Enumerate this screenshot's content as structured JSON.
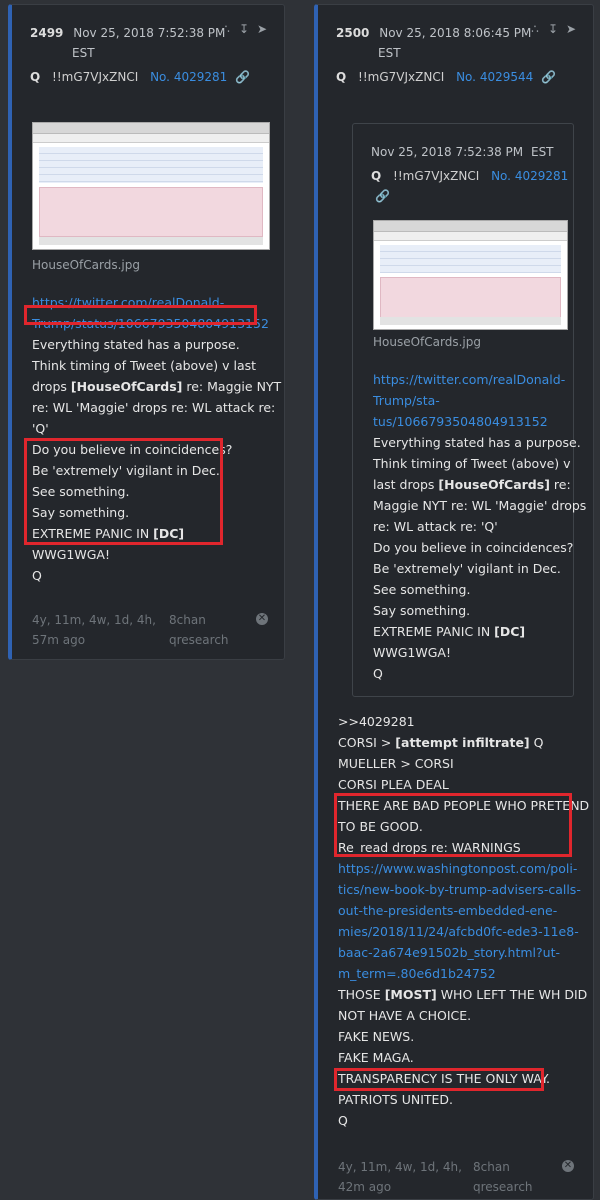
{
  "left_post": {
    "number": "2499",
    "date": "Nov 25, 2018 7:52:38 PM",
    "tz": "EST",
    "author": "Q",
    "tripcode": "!!mG7VJxZNCI",
    "post_no": "No. 4029281",
    "image_name": "HouseOfCards.jpg",
    "lines": [
      {
        "text": "https://twitter.com/realDonald-",
        "type": "link"
      },
      {
        "text": "Trump/status/1066793504804913152",
        "type": "link"
      },
      {
        "text": "Everything stated has a purpose.",
        "type": "text"
      },
      {
        "text": "Think timing of Tweet (above) v last",
        "type": "text"
      },
      {
        "text": "drops [HouseOfCards] re: Maggie NYT",
        "type": "text"
      },
      {
        "text": "re: WL 'Maggie' drops re: WL attack re:",
        "type": "text"
      },
      {
        "text": "'Q'",
        "type": "text"
      },
      {
        "text": "Do you believe in coincidences?",
        "type": "text"
      },
      {
        "text": "Be 'extremely' vigilant in Dec.",
        "type": "text"
      },
      {
        "text": "See something.",
        "type": "text"
      },
      {
        "text": "Say something.",
        "type": "text"
      },
      {
        "text": "EXTREME PANIC IN [DC]",
        "type": "text"
      },
      {
        "text": "WWG1WGA!",
        "type": "text"
      },
      {
        "text": "Q",
        "type": "text"
      }
    ],
    "footer_age": "4y, 11m, 4w, 1d, 4h,",
    "footer_age2": "57m ago",
    "footer_source": "8chan",
    "footer_source2": "qresearch"
  },
  "right_post": {
    "number": "2500",
    "date": "Nov 25, 2018 8:06:45 PM",
    "tz": "EST",
    "author": "Q",
    "tripcode": "!!mG7VJxZNCI",
    "post_no": "No. 4029544",
    "quoted": {
      "date": "Nov 25, 2018 7:52:38 PM",
      "tz": "EST",
      "author": "Q",
      "tripcode": "!!mG7VJxZNCI",
      "post_no": "No. 4029281",
      "image_name": "HouseOfCards.jpg",
      "lines": [
        {
          "text": "https://twitter.com/realDonald-",
          "type": "link"
        },
        {
          "text": "Trump/sta-",
          "type": "link"
        },
        {
          "text": "tus/1066793504804913152",
          "type": "link"
        },
        {
          "text": "Everything stated has a purpose.",
          "type": "text"
        },
        {
          "text": "Think timing of Tweet (above) v",
          "type": "text"
        },
        {
          "text": "last drops [HouseOfCards] re:",
          "type": "text"
        },
        {
          "text": "Maggie NYT re: WL 'Maggie' drops",
          "type": "text"
        },
        {
          "text": "re: WL attack re: 'Q'",
          "type": "text"
        },
        {
          "text": "Do you believe in coincidences?",
          "type": "text"
        },
        {
          "text": "Be 'extremely' vigilant in Dec.",
          "type": "text"
        },
        {
          "text": "See something.",
          "type": "text"
        },
        {
          "text": "Say something.",
          "type": "text"
        },
        {
          "text": "EXTREME PANIC IN [DC]",
          "type": "text"
        },
        {
          "text": "WWG1WGA!",
          "type": "text"
        },
        {
          "text": "Q",
          "type": "text"
        }
      ]
    },
    "lines": [
      {
        "text": ">>4029281",
        "type": "text"
      },
      {
        "text": "CORSI > [attempt infiltrate] Q",
        "type": "text"
      },
      {
        "text": "MUELLER > CORSI",
        "type": "text"
      },
      {
        "text": "CORSI PLEA DEAL",
        "type": "text"
      },
      {
        "text": "THERE ARE BAD PEOPLE WHO PRETEND",
        "type": "text"
      },
      {
        "text": "TO BE GOOD.",
        "type": "text"
      },
      {
        "text": "Re_read drops re: WARNINGS",
        "type": "text"
      },
      {
        "text": "https://www.washingtonpost.com/poli-",
        "type": "link"
      },
      {
        "text": "tics/new-book-by-trump-advisers-calls-",
        "type": "link"
      },
      {
        "text": "out-the-presidents-embedded-ene-",
        "type": "link"
      },
      {
        "text": "mies/2018/11/24/afcbd0fc-ede3-11e8-",
        "type": "link"
      },
      {
        "text": "baac-2a674e91502b_story.html?ut-",
        "type": "link"
      },
      {
        "text": "m_term=.80e6d1b24752",
        "type": "link"
      },
      {
        "text": "THOSE [MOST] WHO LEFT THE WH DID",
        "type": "text"
      },
      {
        "text": "NOT HAVE A CHOICE.",
        "type": "text"
      },
      {
        "text": "FAKE NEWS.",
        "type": "text"
      },
      {
        "text": "FAKE MAGA.",
        "type": "text"
      },
      {
        "text": "TRANSPARENCY IS THE ONLY WAY.",
        "type": "text"
      },
      {
        "text": "PATRIOTS UNITED.",
        "type": "text"
      },
      {
        "text": "Q",
        "type": "text"
      }
    ],
    "footer_age": "4y, 11m, 4w, 1d, 4h,",
    "footer_age2": "42m ago",
    "footer_source": "8chan",
    "footer_source2": "qresearch"
  },
  "colors": {
    "link": "#3a8de0",
    "highlight": "#e0262d",
    "card_border": "#2f62b3"
  },
  "icons": [
    "share-icon",
    "download-icon",
    "forward-icon",
    "link-icon",
    "close-icon"
  ]
}
